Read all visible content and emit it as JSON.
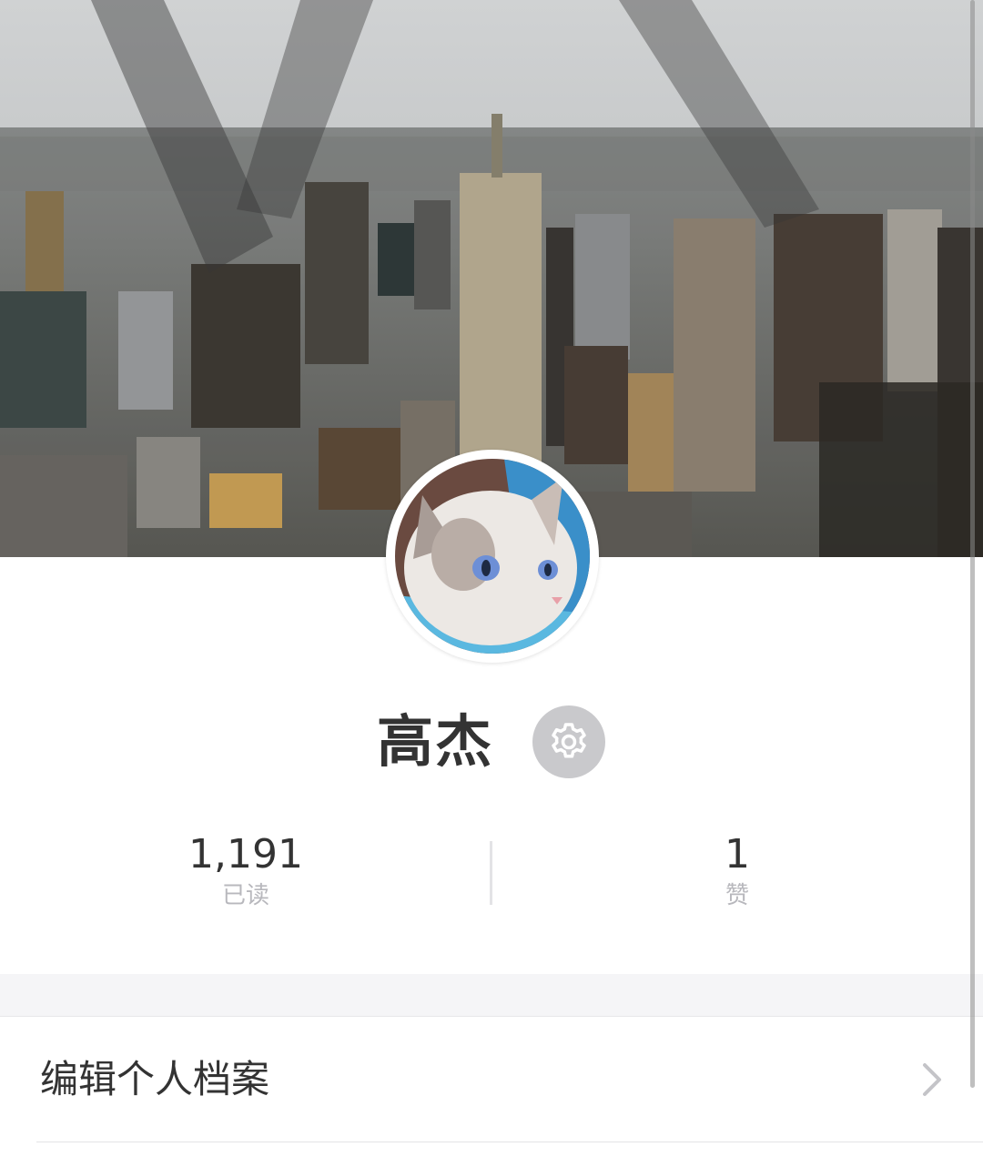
{
  "cover": {
    "image": "city-skyline-photo"
  },
  "profile": {
    "avatar": "cat-photo",
    "name": "高杰",
    "settings_icon": "gear-icon"
  },
  "stats": {
    "read": {
      "value": "1,191",
      "label": "已读"
    },
    "likes": {
      "value": "1",
      "label": "赞"
    }
  },
  "menu": {
    "edit_profile": {
      "label": "编辑个人档案",
      "icon": "chevron-right-icon"
    }
  },
  "colors": {
    "text_primary": "#333333",
    "text_secondary": "#b8b8bd",
    "settings_bg": "#c9c9cc",
    "section_gap": "#f5f5f7"
  }
}
